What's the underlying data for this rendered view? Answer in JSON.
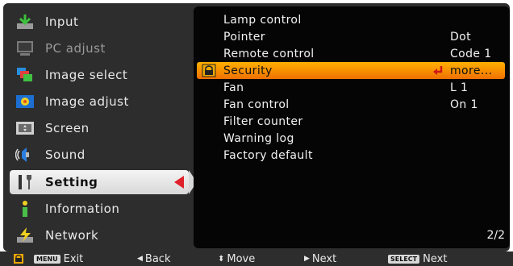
{
  "sidebar": {
    "items": [
      {
        "label": "Input",
        "icon": "input-icon",
        "state": "normal"
      },
      {
        "label": "PC adjust",
        "icon": "pc-adjust-icon",
        "state": "dim"
      },
      {
        "label": "Image select",
        "icon": "image-select-icon",
        "state": "normal"
      },
      {
        "label": "Image adjust",
        "icon": "image-adjust-icon",
        "state": "normal"
      },
      {
        "label": "Screen",
        "icon": "screen-icon",
        "state": "normal"
      },
      {
        "label": "Sound",
        "icon": "sound-icon",
        "state": "normal"
      },
      {
        "label": "Setting",
        "icon": "setting-icon",
        "state": "selected"
      },
      {
        "label": "Information",
        "icon": "information-icon",
        "state": "normal"
      },
      {
        "label": "Network",
        "icon": "network-icon",
        "state": "normal"
      }
    ]
  },
  "panel": {
    "rows": [
      {
        "label": "Lamp control",
        "value": ""
      },
      {
        "label": "Pointer",
        "value": "Dot"
      },
      {
        "label": "Remote control",
        "value": "Code 1"
      },
      {
        "label": "Security",
        "value": "more...",
        "highlight": true
      },
      {
        "label": "Fan",
        "value": "L 1"
      },
      {
        "label": "Fan control",
        "value": "On 1"
      },
      {
        "label": "Filter counter",
        "value": ""
      },
      {
        "label": "Warning log",
        "value": ""
      },
      {
        "label": "Factory default",
        "value": ""
      }
    ],
    "page_indicator": "2/2"
  },
  "bottombar": {
    "menu_key": "MENU",
    "exit_label": "Exit",
    "back_label": "Back",
    "move_label": "Move",
    "next_label": "Next",
    "select_key": "SELECT",
    "select_next_label": "Next"
  },
  "colors": {
    "background": "#2d2d2d",
    "panel": "#050505",
    "highlight": "#f59000",
    "accent_red": "#e0202a"
  }
}
